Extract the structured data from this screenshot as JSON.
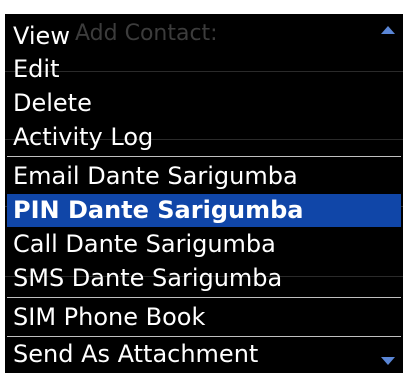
{
  "menu": {
    "items": [
      {
        "label": "View"
      },
      {
        "label": "Edit"
      },
      {
        "label": "Delete"
      },
      {
        "label": "Activity Log"
      },
      {
        "label": "Email Dante Sarigumba"
      },
      {
        "label": "PIN Dante Sarigumba",
        "selected": true
      },
      {
        "label": "Call Dante Sarigumba"
      },
      {
        "label": "SMS Dante Sarigumba"
      },
      {
        "label": "SIM Phone Book"
      },
      {
        "label": "Send As Attachment"
      }
    ],
    "scroll_up_icon": "triangle-up-icon",
    "scroll_down_icon": "triangle-down-icon",
    "selection_color": "#1046a8"
  },
  "background_screen": {
    "title": "Add Contact:"
  }
}
